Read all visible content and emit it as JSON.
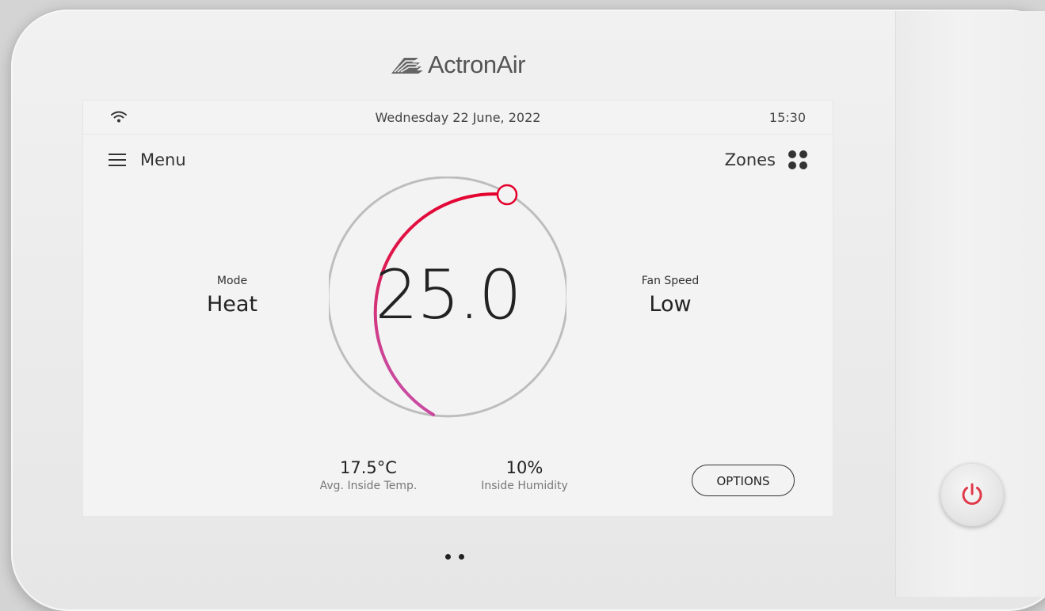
{
  "brand": {
    "name": "ActronAir"
  },
  "status_bar": {
    "date": "Wednesday 22 June, 2022",
    "time": "15:30"
  },
  "nav": {
    "menu_label": "Menu",
    "zones_label": "Zones"
  },
  "mode": {
    "label": "Mode",
    "value": "Heat"
  },
  "fan": {
    "label": "Fan Speed",
    "value": "Low"
  },
  "setpoint": {
    "value": "25.0"
  },
  "readings": {
    "temp_value": "17.5°C",
    "temp_label": "Avg. Inside Temp.",
    "humidity_value": "10%",
    "humidity_label": "Inside Humidity"
  },
  "options_label": "OPTIONS",
  "page_indicator": {
    "count": 2
  },
  "colors": {
    "accent_red": "#e4002b",
    "accent_magenta": "#c94aa0",
    "track_grey": "#bdbdbd",
    "power_red": "#e03a4a"
  },
  "icons": {
    "status": "wifi-icon",
    "menu": "hamburger-icon",
    "zones": "four-dots-icon",
    "power": "power-icon"
  }
}
